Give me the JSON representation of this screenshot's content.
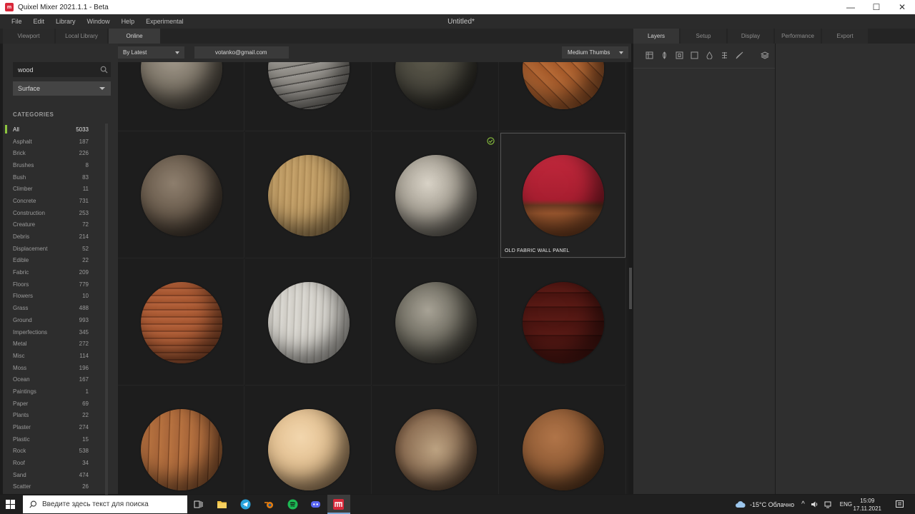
{
  "window": {
    "app_title": "Quixel Mixer 2021.1.1 - Beta",
    "logo_text": "m",
    "minimize": "—",
    "maximize": "☐",
    "close": "✕"
  },
  "menu": [
    "File",
    "Edit",
    "Library",
    "Window",
    "Help",
    "Experimental"
  ],
  "document_title": "Untitled*",
  "left_tabs": [
    {
      "label": "Viewport",
      "active": false
    },
    {
      "label": "Local Library",
      "active": false
    },
    {
      "label": "Online",
      "active": true
    }
  ],
  "right_tabs": [
    {
      "label": "Layers",
      "active": true
    },
    {
      "label": "Setup",
      "active": false
    },
    {
      "label": "Display",
      "active": false
    },
    {
      "label": "Performance",
      "active": false
    },
    {
      "label": "Export",
      "active": false
    }
  ],
  "sidebar": {
    "search_value": "wood",
    "type_filter": "Surface",
    "categories_header": "CATEGORIES",
    "categories": [
      {
        "name": "All",
        "count": "5033",
        "active": true
      },
      {
        "name": "Asphalt",
        "count": "187"
      },
      {
        "name": "Brick",
        "count": "226"
      },
      {
        "name": "Brushes",
        "count": "8"
      },
      {
        "name": "Bush",
        "count": "83"
      },
      {
        "name": "Climber",
        "count": "11"
      },
      {
        "name": "Concrete",
        "count": "731"
      },
      {
        "name": "Construction",
        "count": "253"
      },
      {
        "name": "Creature",
        "count": "72"
      },
      {
        "name": "Debris",
        "count": "214"
      },
      {
        "name": "Displacement",
        "count": "52"
      },
      {
        "name": "Edible",
        "count": "22"
      },
      {
        "name": "Fabric",
        "count": "209"
      },
      {
        "name": "Floors",
        "count": "779"
      },
      {
        "name": "Flowers",
        "count": "10"
      },
      {
        "name": "Grass",
        "count": "488"
      },
      {
        "name": "Ground",
        "count": "993"
      },
      {
        "name": "Imperfections",
        "count": "345"
      },
      {
        "name": "Metal",
        "count": "272"
      },
      {
        "name": "Misc",
        "count": "114"
      },
      {
        "name": "Moss",
        "count": "196"
      },
      {
        "name": "Ocean",
        "count": "167"
      },
      {
        "name": "Paintings",
        "count": "1"
      },
      {
        "name": "Paper",
        "count": "69"
      },
      {
        "name": "Plants",
        "count": "22"
      },
      {
        "name": "Plaster",
        "count": "274"
      },
      {
        "name": "Plastic",
        "count": "15"
      },
      {
        "name": "Rock",
        "count": "538"
      },
      {
        "name": "Roof",
        "count": "34"
      },
      {
        "name": "Sand",
        "count": "474"
      },
      {
        "name": "Scatter",
        "count": "26"
      }
    ]
  },
  "toolbar": {
    "sort": "By Latest",
    "account": "votanko@gmail.com",
    "thumb_size": "Medium Thumbs"
  },
  "grid": {
    "hovered_label": "OLD FABRIC WALL PANEL"
  },
  "colors": {
    "accent_green": "#8dc63f",
    "app_red": "#d9283a"
  },
  "taskbar": {
    "search_placeholder": "Введите здесь текст для поиска",
    "weather": "-15°C  Облачно",
    "language": "ENG",
    "time": "15:09",
    "date": "17.11.2021"
  }
}
